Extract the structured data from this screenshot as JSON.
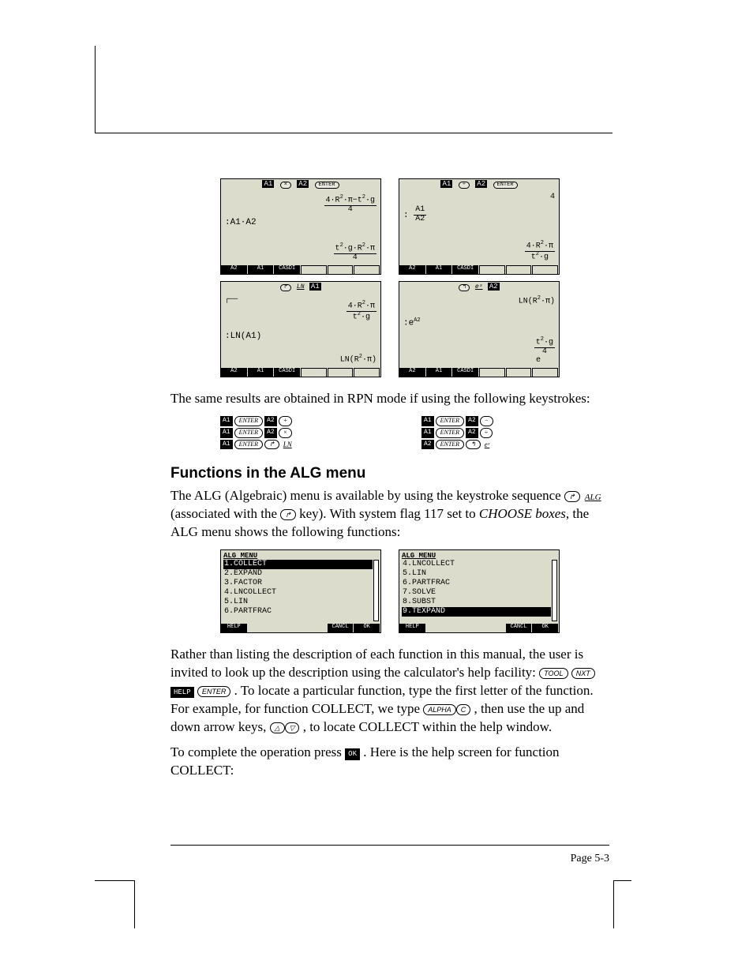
{
  "calc_screens": {
    "top_left": {
      "head_keys": [
        "A1",
        "×",
        "A2",
        "ENTER"
      ],
      "left_lines": [
        ":A1·A2"
      ],
      "right_top": "4·R²·π−t²·g\n─────────\n    4",
      "right_bottom": "t²·g·R²·π\n────────\n    4",
      "menu": [
        "A2",
        "A1",
        "CASDI",
        "",
        "",
        ""
      ]
    },
    "top_right": {
      "head_keys": [
        "A1",
        "÷",
        "A2",
        "ENTER"
      ],
      "left_lines": [
        ": A1",
        " ──",
        " A2"
      ],
      "right_top": "4",
      "right_bottom": "4·R²·π\n──────\n t²·g",
      "menu": [
        "A2",
        "A1",
        "CASDI",
        "",
        "",
        ""
      ]
    },
    "mid_left": {
      "head_keys": [
        "↱",
        "LN",
        "A1"
      ],
      "left_lines": [
        ":LN(A1)"
      ],
      "right_top": "4·R²·π\n──────\n t²·g",
      "right_bottom": "LN(R²·π)",
      "menu": [
        "A2",
        "A1",
        "CASDI",
        "",
        "",
        ""
      ]
    },
    "mid_right": {
      "head_keys": [
        "↰",
        "eˣ",
        "A2"
      ],
      "left_lines": [
        ":e^A2"
      ],
      "right_top": "LN(R²·π)",
      "right_bottom": " t²·g\n ────\n  4 \n e",
      "menu": [
        "A2",
        "A1",
        "CASDI",
        "",
        "",
        ""
      ]
    }
  },
  "rpn_intro": "The same results are obtained in RPN mode if using the following keystrokes:",
  "rpn_rows": [
    {
      "left": [
        "A1",
        "ENTER",
        "A2",
        "+"
      ],
      "right": [
        "A1",
        "ENTER",
        "A2",
        "−"
      ]
    },
    {
      "left": [
        "A1",
        "ENTER",
        "A2",
        "×"
      ],
      "right": [
        "A1",
        "ENTER",
        "A2",
        "÷"
      ]
    },
    {
      "left": [
        "A1",
        "ENTER",
        "↱",
        "LN"
      ],
      "right": [
        "A2",
        "ENTER",
        "↰",
        "eˣ"
      ]
    }
  ],
  "heading": "Functions in the ALG menu",
  "para1a": "The ALG (Algebraic) menu is available by using the keystroke sequence ",
  "para1b": " (associated with the ",
  "para1c": " key).   With system flag 117 set to ",
  "para1d": "CHOOSE boxes",
  "para1e": ", the ALG menu shows the following functions:",
  "alg_menu": {
    "title": "ALG MENU",
    "left_items": [
      {
        "n": "1",
        "t": "COLLECT",
        "sel": true
      },
      {
        "n": "2",
        "t": "EXPAND",
        "sel": false
      },
      {
        "n": "3",
        "t": "FACTOR",
        "sel": false
      },
      {
        "n": "4",
        "t": "LNCOLLECT",
        "sel": false
      },
      {
        "n": "5",
        "t": "LIN",
        "sel": false
      },
      {
        "n": "6",
        "t": "PARTFRAC",
        "sel": false
      }
    ],
    "right_items": [
      {
        "n": "4",
        "t": "LNCOLLECT",
        "sel": false
      },
      {
        "n": "5",
        "t": "LIN",
        "sel": false
      },
      {
        "n": "6",
        "t": "PARTFRAC",
        "sel": false
      },
      {
        "n": "7",
        "t": "SOLVE",
        "sel": false
      },
      {
        "n": "8",
        "t": "SUBST",
        "sel": false
      },
      {
        "n": "9",
        "t": "TEXPAND",
        "sel": true
      }
    ],
    "menu_labels": [
      "HELP",
      "",
      "",
      "",
      "CANCL",
      "OK"
    ]
  },
  "para2a": "Rather than listing the description of each function in this manual, the user is invited to look up the description using the calculator's help facility: ",
  "para2b": " .  To locate a particular function, type the first letter of the function.  For example, for function COLLECT, we type ",
  "para2c": " , then use the up and down arrow keys, ",
  "para2d": " , to locate COLLECT within the help window.",
  "para3a": "To complete the operation press ",
  "para3b": ".  Here is the help screen for function COLLECT:",
  "keys": {
    "right_shift": "↱",
    "left_shift": "↰",
    "alg": "ALG",
    "tool": "TOOL",
    "nxt": "NXT",
    "help": "HELP",
    "enter": "ENTER",
    "alpha": "ALPHA",
    "c": "C",
    "ok": "OK",
    "up": "△",
    "down": "▽",
    "ln": "LN",
    "ex": "eˣ"
  },
  "page_number": "Page 5-3"
}
